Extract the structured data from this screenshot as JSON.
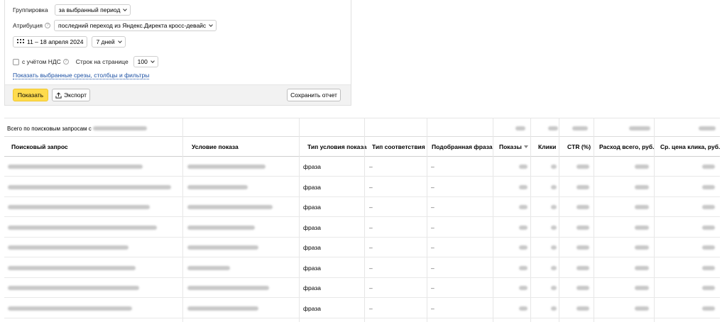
{
  "settings": {
    "grouping_label": "Группировка",
    "grouping_value": "за выбранный период",
    "attribution_label": "Атрибуция",
    "attribution_value": "последний переход из Яндекс.Директа кросс-девайс",
    "date_range": "11 – 18 апреля 2024",
    "period_value": "7 дней",
    "vat_label": "с учётом НДС",
    "rows_per_page_label": "Строк на странице",
    "rows_per_page_value": "100",
    "show_selected_link": "Показать выбранные срезы, столбцы и фильтры"
  },
  "actions": {
    "show_label": "Показать",
    "export_label": "Экспорт",
    "save_report_label": "Сохранить отчет"
  },
  "table": {
    "summary_label": "Всего по поисковым запросам с",
    "columns": [
      "Поисковый запрос",
      "Условие показа",
      "Тип условия показа",
      "Тип соответствия",
      "Подобранная фраза",
      "Показы",
      "Клики",
      "CTR (%)",
      "Расход всего, руб.",
      "Ср. цена клика, руб."
    ],
    "rows": [
      {
        "type": "фраза",
        "match": "–",
        "phrase": "–"
      },
      {
        "type": "фраза",
        "match": "–",
        "phrase": "–"
      },
      {
        "type": "фраза",
        "match": "–",
        "phrase": "–"
      },
      {
        "type": "фраза",
        "match": "–",
        "phrase": "–"
      },
      {
        "type": "фраза",
        "match": "–",
        "phrase": "–"
      },
      {
        "type": "фраза",
        "match": "–",
        "phrase": "–"
      },
      {
        "type": "фраза",
        "match": "–",
        "phrase": "–"
      },
      {
        "type": "фраза",
        "match": "–",
        "phrase": "–"
      }
    ]
  }
}
